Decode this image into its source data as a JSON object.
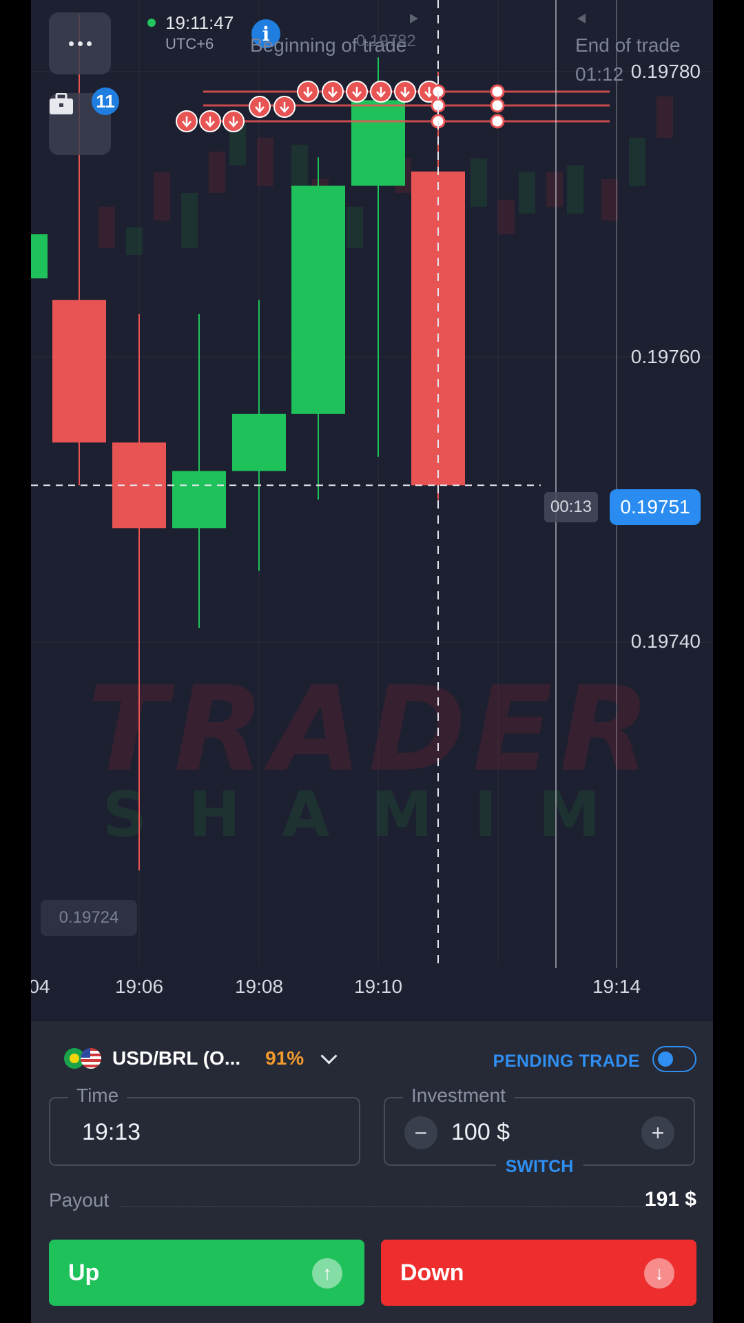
{
  "header": {
    "menu_icon": "more-horizontal-icon",
    "portfolio_icon": "briefcase-icon",
    "portfolio_badge": "11",
    "time": "19:11:47",
    "timezone": "UTC+6",
    "info_icon": "i"
  },
  "chart": {
    "beginning_label": "Beginning of trade",
    "end_label": "End of trade",
    "end_time_partial": "01:12",
    "ghost_price": "0.19782",
    "price_labels": [
      "0.19780",
      "0.19760",
      "0.19740"
    ],
    "current_price": "0.19751",
    "countdown": "00:13",
    "low_price": "0.19724",
    "x_ticks": [
      "04",
      "19:06",
      "19:08",
      "19:10",
      "19:14"
    ],
    "watermark_line1": "TRADER",
    "watermark_line2": "SHAMIM",
    "colors": {
      "up": "#1fc25a",
      "down": "#e85454",
      "accent": "#2a8cf0"
    }
  },
  "chart_data": {
    "type": "candlestick",
    "y_ticks": [
      0.1978,
      0.1976,
      0.1974
    ],
    "current_price": 0.19751,
    "candles": [
      {
        "time": "19:05",
        "open": 0.19764,
        "close": 0.19754,
        "high": 0.19784,
        "low": 0.19751,
        "dir": "down"
      },
      {
        "time": "19:06",
        "open": 0.19754,
        "close": 0.19748,
        "high": 0.19763,
        "low": 0.19724,
        "dir": "down"
      },
      {
        "time": "19:07",
        "open": 0.19748,
        "close": 0.19752,
        "high": 0.19763,
        "low": 0.19741,
        "dir": "up"
      },
      {
        "time": "19:08",
        "open": 0.19752,
        "close": 0.19756,
        "high": 0.19764,
        "low": 0.19745,
        "dir": "up"
      },
      {
        "time": "19:09",
        "open": 0.19756,
        "close": 0.19772,
        "high": 0.19774,
        "low": 0.1975,
        "dir": "up"
      },
      {
        "time": "19:10",
        "open": 0.19772,
        "close": 0.19778,
        "high": 0.19781,
        "low": 0.19753,
        "dir": "up"
      },
      {
        "time": "19:11",
        "open": 0.19773,
        "close": 0.19751,
        "high": 0.1978,
        "low": 0.1975,
        "dir": "down"
      }
    ]
  },
  "panel": {
    "asset": "USD/BRL (O...",
    "payout_pct": "91%",
    "pending_label": "PENDING TRADE",
    "time_label": "Time",
    "time_value": "19:13",
    "investment_label": "Investment",
    "investment_value": "100 $",
    "minus": "−",
    "plus": "+",
    "switch_label": "SWITCH",
    "payout_label": "Payout",
    "payout_value": "191 $",
    "up_label": "Up",
    "down_label": "Down",
    "up_icon": "↑",
    "down_icon": "↓"
  }
}
